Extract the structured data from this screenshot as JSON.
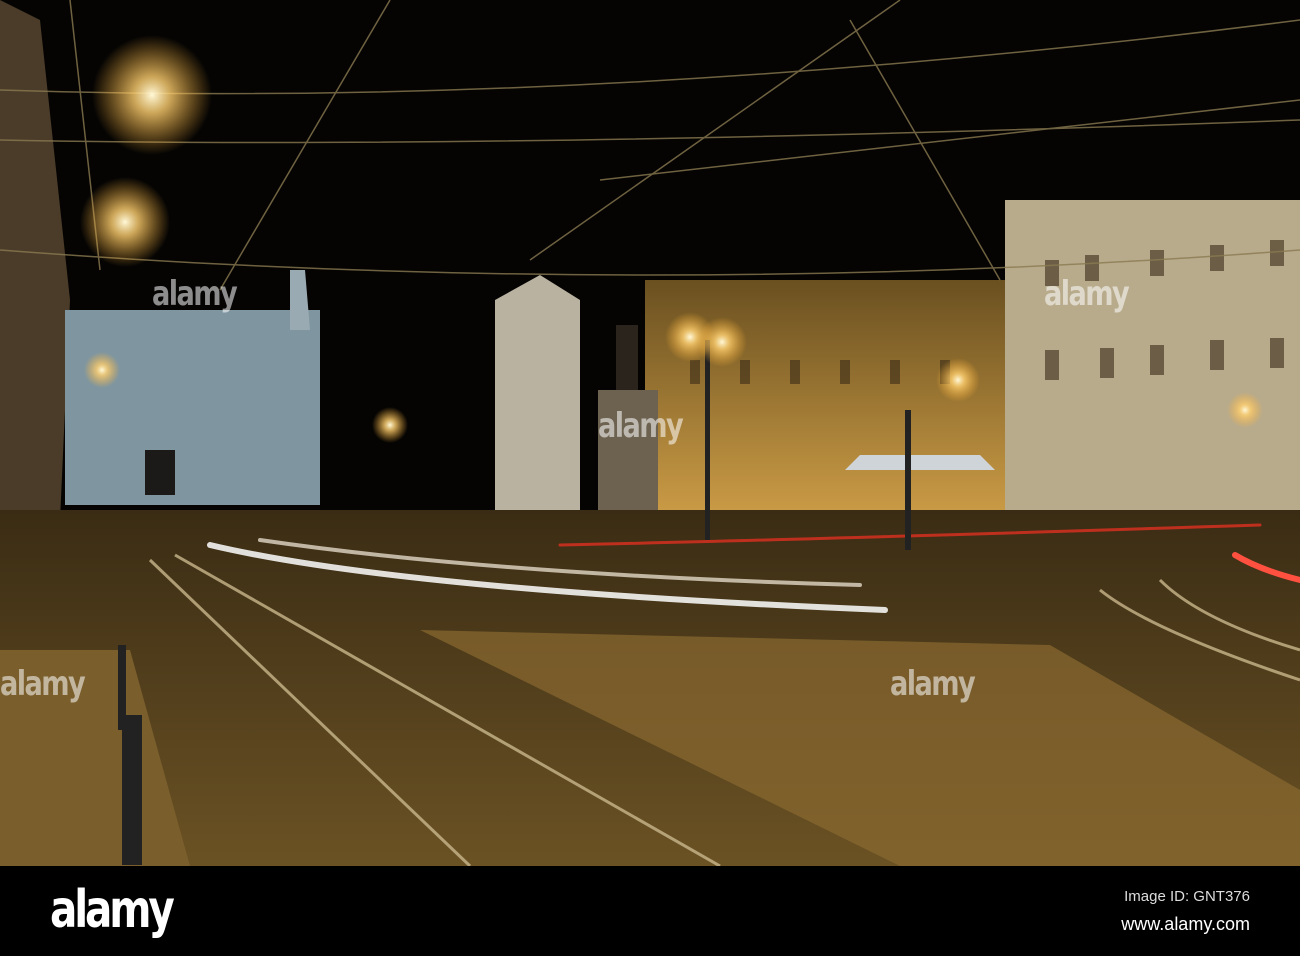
{
  "watermark": "alamy",
  "footer": {
    "logo": "alamy",
    "image_id": "Image ID: GNT376",
    "website": "www.alamy.com"
  }
}
